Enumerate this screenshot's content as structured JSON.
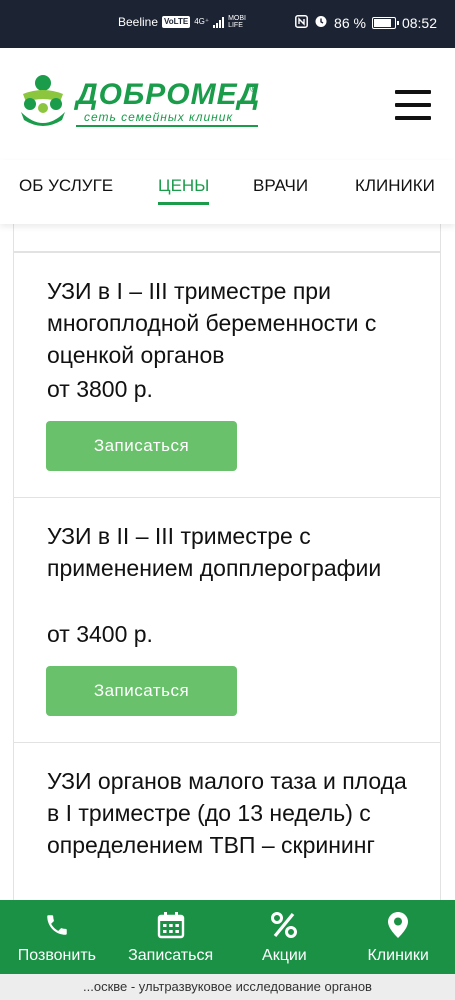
{
  "status_bar": {
    "carrier": "Beeline",
    "volte": "VoLTE",
    "network": "4G⁺",
    "data_badge": "MOBI LIFE",
    "battery": "86 %",
    "battery_level": 0.86,
    "time": "08:52"
  },
  "header": {
    "logo_name": "ДОБРОМЕД",
    "logo_reg": "®",
    "logo_sub": "сеть семейных клиник"
  },
  "tabs": [
    {
      "label": "ОБ УСЛУГЕ",
      "active": false
    },
    {
      "label": "ЦЕНЫ",
      "active": true
    },
    {
      "label": "ВРАЧИ",
      "active": false
    },
    {
      "label": "КЛИНИКИ",
      "active": false
    }
  ],
  "cards": [
    {
      "title": "УЗИ в I – III триместре при многоплодной беременности с оценкой органов",
      "price": "от 3800 р.",
      "button": "Записаться"
    },
    {
      "title": "УЗИ в II – III триместре с применением допплерографии",
      "price": "от 3400 р.",
      "button": "Записаться"
    },
    {
      "title": "УЗИ органов малого таза и плода в I триместре (до 13 недель) с определением ТВП – скрининг"
    }
  ],
  "bottom_nav": [
    {
      "label": "Позвонить",
      "icon": "phone-icon"
    },
    {
      "label": "Записаться",
      "icon": "calendar-icon"
    },
    {
      "label": "Акции",
      "icon": "percent-icon"
    },
    {
      "label": "Клиники",
      "icon": "location-pin-icon"
    }
  ],
  "page_caption": "...оскве - ультразвуковое исследование органов",
  "colors": {
    "brand_green": "#1a9c4a",
    "button_green": "#69c16b",
    "nav_green": "#1b9146",
    "status_bar": "#1c2333"
  }
}
